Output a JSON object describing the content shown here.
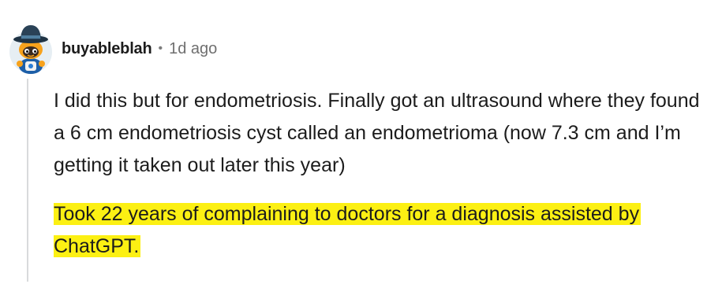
{
  "comment": {
    "username": "buyableblah",
    "separator": "•",
    "timestamp": "1d ago",
    "avatar_icon": "snoo-avatar-icon",
    "paragraphs": [
      "I did this but for endometriosis. Finally got an ultrasound where they found a 6 cm endometriosis cyst called an endometrioma (now 7.3 cm and I’m getting it taken out later this year)",
      "Took 22 years of complaining to doctors for a diagnosis assisted by ChatGPT."
    ],
    "highlight_color": "#fcf013",
    "thread_line_color": "#d8dadc"
  }
}
